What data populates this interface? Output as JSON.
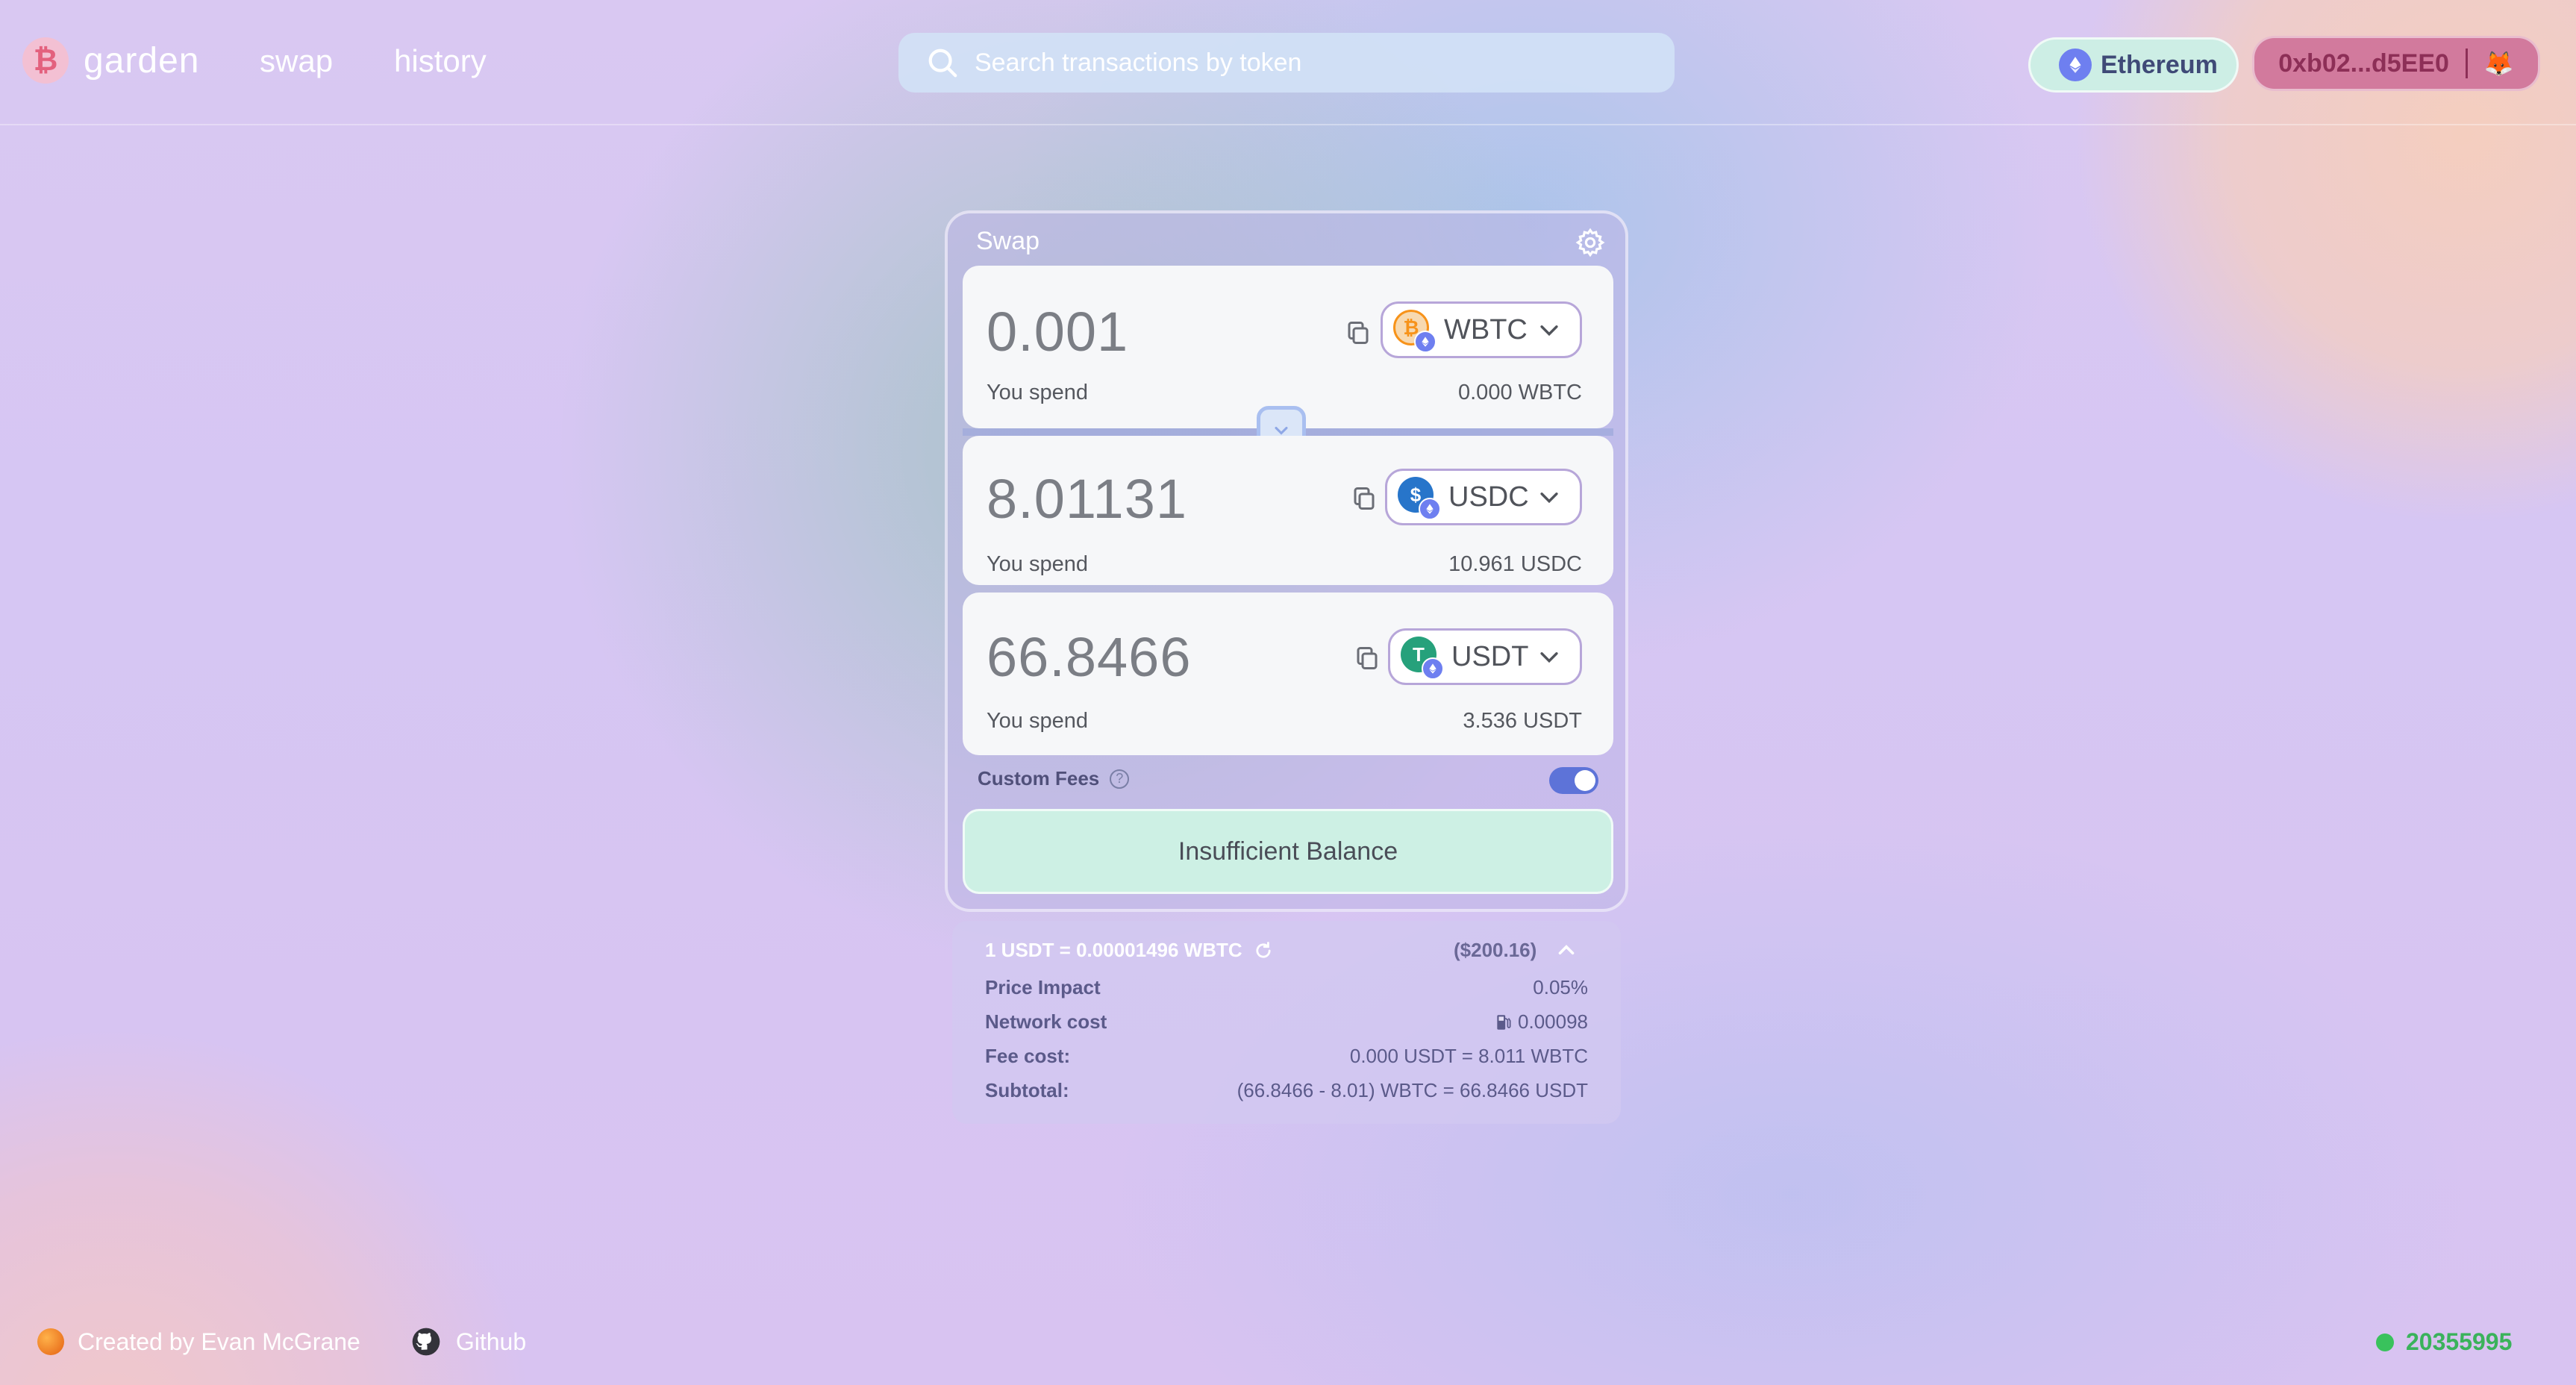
{
  "header": {
    "logo_mark": "₿",
    "logo_text": "garden",
    "nav": {
      "swap": "swap",
      "history": "history"
    },
    "search_placeholder": "Search transactions by token",
    "network": {
      "label": "Ethereum",
      "icon": "ethereum-icon"
    },
    "wallet": {
      "address": "0xb02...d5EE0",
      "icon": "metamask-fox-icon"
    }
  },
  "swap": {
    "title": "Swap",
    "inputs": [
      {
        "amount": "0.001",
        "token": "WBTC",
        "label": "You spend",
        "balance": "0.000 WBTC",
        "logo_color": "#f7931a",
        "logo_glyph": "₿"
      },
      {
        "amount": "8.01131",
        "token": "USDC",
        "label": "You spend",
        "balance": "10.961 USDC",
        "logo_color": "#2775ca",
        "logo_glyph": "$"
      },
      {
        "amount": "66.8466",
        "token": "USDT",
        "label": "You spend",
        "balance": "3.536 USDT",
        "logo_color": "#26a17b",
        "logo_glyph": "T"
      }
    ],
    "custom_fees_label": "Custom Fees",
    "custom_fees_enabled": true,
    "action_label": "Insufficient Balance"
  },
  "details": {
    "rate": "1 USDT = 0.00001496 WBTC",
    "usd_total": "($200.16)",
    "rows": [
      {
        "label": "Price Impact",
        "value": "0.05%"
      },
      {
        "label": "Network cost",
        "value": "0.00098"
      },
      {
        "label": "Fee cost:",
        "value": "0.000 USDT = 8.011 WBTC"
      },
      {
        "label": "Subtotal:",
        "value": "(66.8466 - 8.01) WBTC = 66.8466 USDT"
      }
    ]
  },
  "footer": {
    "creator": "Created by Evan McGrane",
    "github": "Github",
    "block_number": "20355995"
  },
  "colors": {
    "accent": "#5d73d8",
    "action_bg": "#cdf0e4",
    "wallet_bg": "#d27a9d",
    "network_bg": "#cdeee5",
    "status_green": "#39c25c"
  }
}
